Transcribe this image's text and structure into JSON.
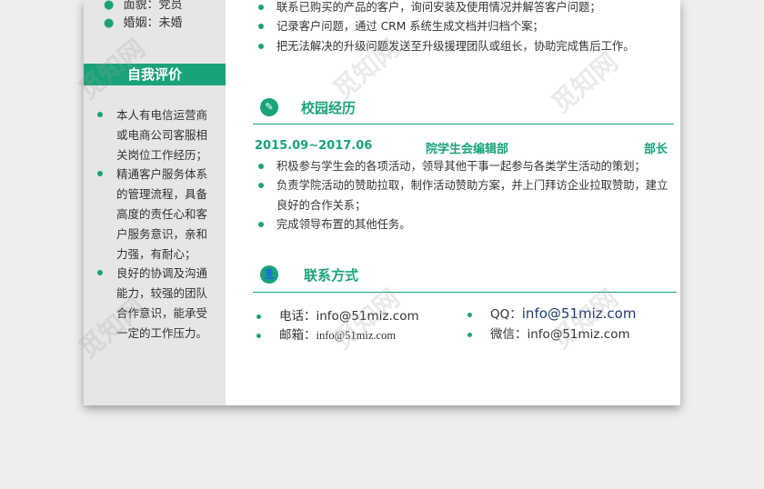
{
  "sidebar": {
    "appearance": {
      "label": "面貌：",
      "value": "党员"
    },
    "marital": {
      "label": "婚姻：",
      "value": "未婚"
    },
    "self_eval_title": "自我评价",
    "self_eval_items": [
      "本人有电信运营商或电商公司客服相关岗位工作经历；",
      "精通客户服务体系的管理流程，具备高度的责任心和客户服务意识，亲和力强，有耐心；",
      "良好的协调及沟通能力，较强的团队合作意识，能承受一定的工作压力。"
    ]
  },
  "work_items": [
    "联系已购买的产品的客户，询问安装及使用情况并解答客户问题；",
    "记录客户问题，通过 CRM 系统生成文档并归档个案；",
    "把无法解决的升级问题发送至升级援理团队或组长，协助完成售后工作。"
  ],
  "campus": {
    "title": "校园经历",
    "period": "2015.09~2017.06",
    "org": "院学生会编辑部",
    "role": "部长",
    "items": [
      "积极参与学生会的各项活动，领导其他干事一起参与各类学生活动的策划；",
      "负责学院活动的赞助拉取，制作活动赞助方案，并上门拜访企业拉取赞助，建立良好的合作关系；",
      "完成领导布置的其他任务。"
    ]
  },
  "contact": {
    "title": "联系方式",
    "phone": {
      "label": "电话：",
      "value": "info@51miz.com"
    },
    "email": {
      "label": "邮箱：",
      "value": "info@51miz.com"
    },
    "qq": {
      "label": "QQ：",
      "value": "info@51miz.com"
    },
    "wechat": {
      "label": "微信：",
      "value": "info@51miz.com"
    }
  },
  "watermark_text": "觅知网",
  "colors": {
    "accent": "#1aa37a",
    "sidebar_bg": "#e6e6e6"
  },
  "icons": {
    "campus": "edit-icon",
    "contact": "person-icon"
  }
}
